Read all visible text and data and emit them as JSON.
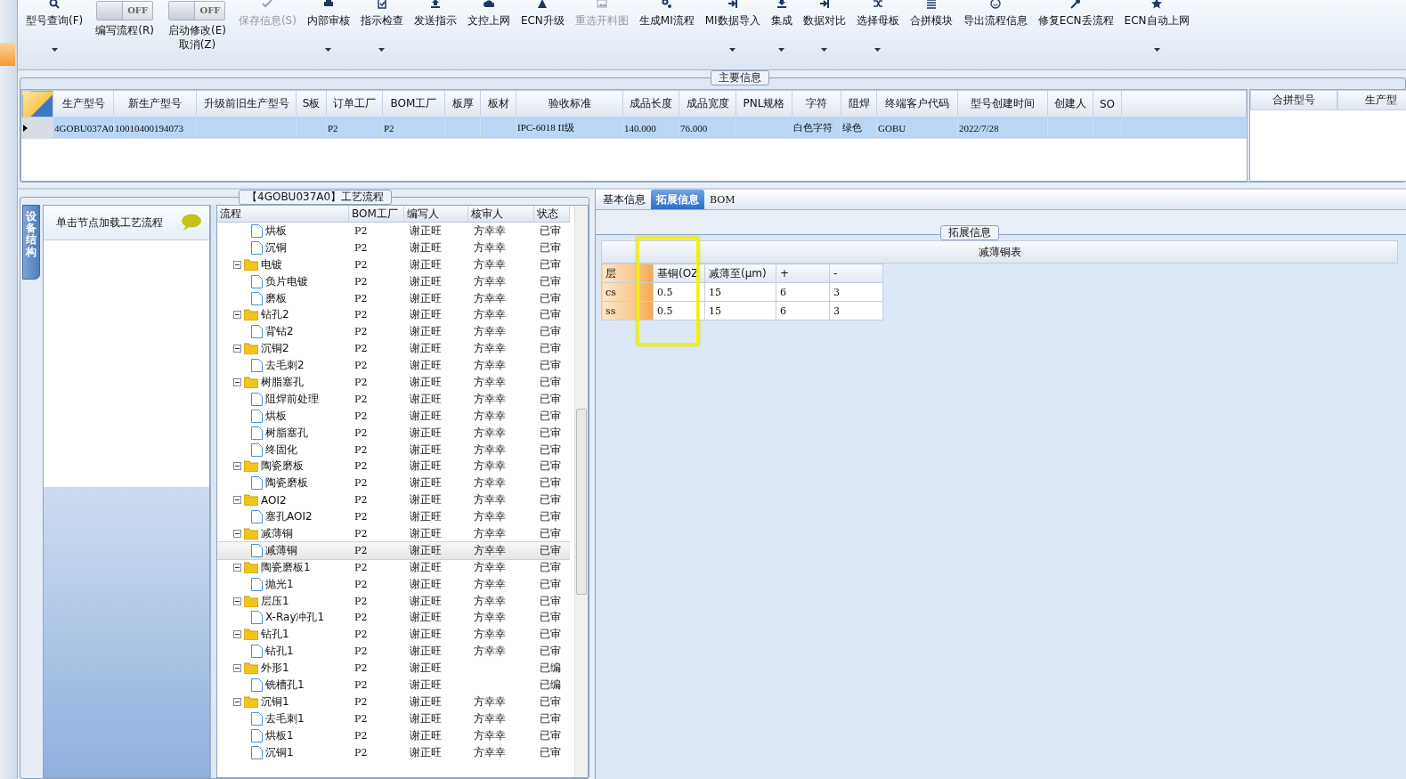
{
  "toolbar": {
    "items": [
      {
        "kind": "button",
        "label": "型号查询(F)",
        "disabled": false,
        "dropdown": true
      },
      {
        "kind": "toggle",
        "switch_text": "OFF",
        "on": false,
        "caption": [
          "编写流程(R)"
        ]
      },
      {
        "kind": "toggle",
        "switch_text": "OFF",
        "on": false,
        "caption": [
          "启动修改(E)",
          "取消(Z)"
        ]
      },
      {
        "kind": "button",
        "label": "保存信息(S)",
        "disabled": true,
        "dropdown": false
      },
      {
        "kind": "button",
        "label": "内部审核",
        "disabled": false,
        "dropdown": true
      },
      {
        "kind": "button",
        "label": "指示检查",
        "disabled": false,
        "dropdown": true
      },
      {
        "kind": "button",
        "label": "发送指示",
        "disabled": false,
        "dropdown": false
      },
      {
        "kind": "button",
        "label": "文控上网",
        "disabled": false,
        "dropdown": false
      },
      {
        "kind": "button",
        "label": "ECN升级",
        "disabled": false,
        "dropdown": false
      },
      {
        "kind": "button",
        "label": "重选开料图",
        "disabled": true,
        "dropdown": false
      },
      {
        "kind": "button",
        "label": "生成MI流程",
        "disabled": false,
        "dropdown": false
      },
      {
        "kind": "button",
        "label": "MI数据导入",
        "disabled": false,
        "dropdown": true
      },
      {
        "kind": "button",
        "label": "集成",
        "disabled": false,
        "dropdown": true
      },
      {
        "kind": "button",
        "label": "数据对比",
        "disabled": false,
        "dropdown": true
      },
      {
        "kind": "button",
        "label": "选择母板",
        "disabled": false,
        "dropdown": true
      },
      {
        "kind": "button",
        "label": "合拼模块",
        "disabled": false,
        "dropdown": false
      },
      {
        "kind": "button",
        "label": "导出流程信息",
        "disabled": false,
        "dropdown": false
      },
      {
        "kind": "button",
        "label": "修复ECN丢流程",
        "disabled": false,
        "dropdown": false
      },
      {
        "kind": "button",
        "label": "ECN自动上网",
        "disabled": false,
        "dropdown": true
      }
    ]
  },
  "main_info": {
    "title": "主要信息",
    "columns": [
      "生产型号",
      "新生产型号",
      "升级前旧生产型号",
      "S板",
      "订单工厂",
      "BOM工厂",
      "板厚",
      "板材",
      "验收标准",
      "成品长度",
      "成品宽度",
      "PNL规格",
      "字符",
      "阻焊",
      "终端客户代码",
      "型号创建时间",
      "创建人",
      "SO"
    ],
    "rows": [
      {
        "selected": true,
        "cells": [
          "4GOBU037A0",
          "10010400194073",
          null,
          null,
          "P2",
          "P2",
          null,
          null,
          "IPC-6018 II级",
          "140.000",
          "76.000",
          null,
          "白色字符",
          "绿色",
          "GOBU",
          "2022/7/28",
          null,
          null
        ]
      }
    ],
    "merge_table": {
      "columns": [
        "合拼型号",
        "生产型"
      ]
    }
  },
  "process_panel": {
    "title": "【4GOBU037A0】工艺流程",
    "side_tab": "设备结构",
    "hint": "单击节点加载工艺流程",
    "tree": {
      "columns": [
        "流程",
        "BOM工厂",
        "编写人",
        "核审人",
        "状态"
      ],
      "nodes": [
        {
          "kind": "step",
          "label": "烘板",
          "selected": false,
          "bom": "P2",
          "writer": "谢正旺",
          "reviewer": "方幸幸",
          "status": "已审"
        },
        {
          "kind": "step",
          "label": "沉铜",
          "selected": false,
          "bom": "P2",
          "writer": "谢正旺",
          "reviewer": "方幸幸",
          "status": "已审"
        },
        {
          "kind": "group",
          "label": "电镀",
          "selected": false,
          "expanded": true,
          "bom": "P2",
          "writer": "谢正旺",
          "reviewer": "方幸幸",
          "status": "已审",
          "children": [
            {
              "kind": "step",
              "label": "负片电镀",
              "selected": false,
              "bom": "P2",
              "writer": "谢正旺",
              "reviewer": "方幸幸",
              "status": "已审"
            },
            {
              "kind": "step",
              "label": "磨板",
              "selected": false,
              "bom": "P2",
              "writer": "谢正旺",
              "reviewer": "方幸幸",
              "status": "已审"
            }
          ]
        },
        {
          "kind": "group",
          "label": "钻孔2",
          "selected": false,
          "expanded": true,
          "bom": "P2",
          "writer": "谢正旺",
          "reviewer": "方幸幸",
          "status": "已审",
          "children": [
            {
              "kind": "step",
              "label": "背钻2",
              "selected": false,
              "bom": "P2",
              "writer": "谢正旺",
              "reviewer": "方幸幸",
              "status": "已审"
            }
          ]
        },
        {
          "kind": "group",
          "label": "沉铜2",
          "selected": false,
          "expanded": true,
          "bom": "P2",
          "writer": "谢正旺",
          "reviewer": "方幸幸",
          "status": "已审",
          "children": [
            {
              "kind": "step",
              "label": "去毛刺2",
              "selected": false,
              "bom": "P2",
              "writer": "谢正旺",
              "reviewer": "方幸幸",
              "status": "已审"
            }
          ]
        },
        {
          "kind": "group",
          "label": "树脂塞孔",
          "selected": false,
          "expanded": true,
          "bom": "P2",
          "writer": "谢正旺",
          "reviewer": "方幸幸",
          "status": "已审",
          "children": [
            {
              "kind": "step",
              "label": "阻焊前处理",
              "selected": false,
              "bom": "P2",
              "writer": "谢正旺",
              "reviewer": "方幸幸",
              "status": "已审"
            },
            {
              "kind": "step",
              "label": "烘板",
              "selected": false,
              "bom": "P2",
              "writer": "谢正旺",
              "reviewer": "方幸幸",
              "status": "已审"
            },
            {
              "kind": "step",
              "label": "树脂塞孔",
              "selected": false,
              "bom": "P2",
              "writer": "谢正旺",
              "reviewer": "方幸幸",
              "status": "已审"
            },
            {
              "kind": "step",
              "label": "终固化",
              "selected": false,
              "bom": "P2",
              "writer": "谢正旺",
              "reviewer": "方幸幸",
              "status": "已审"
            }
          ]
        },
        {
          "kind": "group",
          "label": "陶瓷磨板",
          "selected": false,
          "expanded": true,
          "bom": "P2",
          "writer": "谢正旺",
          "reviewer": "方幸幸",
          "status": "已审",
          "children": [
            {
              "kind": "step",
              "label": "陶瓷磨板",
              "selected": false,
              "bom": "P2",
              "writer": "谢正旺",
              "reviewer": "方幸幸",
              "status": "已审"
            }
          ]
        },
        {
          "kind": "group",
          "label": "AOI2",
          "selected": false,
          "expanded": true,
          "bom": "P2",
          "writer": "谢正旺",
          "reviewer": "方幸幸",
          "status": "已审",
          "children": [
            {
              "kind": "step",
              "label": "塞孔AOI2",
              "selected": false,
              "bom": "P2",
              "writer": "谢正旺",
              "reviewer": "方幸幸",
              "status": "已审"
            }
          ]
        },
        {
          "kind": "group",
          "label": "减薄铜",
          "selected": false,
          "expanded": true,
          "bom": "P2",
          "writer": "谢正旺",
          "reviewer": "方幸幸",
          "status": "已审",
          "children": [
            {
              "kind": "step",
              "label": "减薄铜",
              "selected": true,
              "bom": "P2",
              "writer": "谢正旺",
              "reviewer": "方幸幸",
              "status": "已审"
            }
          ]
        },
        {
          "kind": "group",
          "label": "陶瓷磨板1",
          "selected": false,
          "expanded": true,
          "bom": "P2",
          "writer": "谢正旺",
          "reviewer": "方幸幸",
          "status": "已审",
          "children": [
            {
              "kind": "step",
              "label": "抛光1",
              "selected": false,
              "bom": "P2",
              "writer": "谢正旺",
              "reviewer": "方幸幸",
              "status": "已审"
            }
          ]
        },
        {
          "kind": "group",
          "label": "层压1",
          "selected": false,
          "expanded": true,
          "bom": "P2",
          "writer": "谢正旺",
          "reviewer": "方幸幸",
          "status": "已审",
          "children": [
            {
              "kind": "step",
              "label": "X-Ray冲孔1",
              "selected": false,
              "bom": "P2",
              "writer": "谢正旺",
              "reviewer": "方幸幸",
              "status": "已审"
            }
          ]
        },
        {
          "kind": "group",
          "label": "钻孔1",
          "selected": false,
          "expanded": true,
          "bom": "P2",
          "writer": "谢正旺",
          "reviewer": "方幸幸",
          "status": "已审",
          "children": [
            {
              "kind": "step",
              "label": "钻孔1",
              "selected": false,
              "bom": "P2",
              "writer": "谢正旺",
              "reviewer": "方幸幸",
              "status": "已审"
            }
          ]
        },
        {
          "kind": "group",
          "label": "外形1",
          "selected": false,
          "expanded": true,
          "bom": "P2",
          "writer": "谢正旺",
          "status": "已编",
          "children": [
            {
              "kind": "step",
              "label": "铣槽孔1",
              "selected": false,
              "bom": "P2",
              "writer": "谢正旺",
              "status": "已编"
            }
          ]
        },
        {
          "kind": "group",
          "label": "沉铜1",
          "selected": false,
          "expanded": true,
          "bom": "P2",
          "writer": "谢正旺",
          "reviewer": "方幸幸",
          "status": "已审",
          "children": [
            {
              "kind": "step",
              "label": "去毛刺1",
              "selected": false,
              "bom": "P2",
              "writer": "谢正旺",
              "reviewer": "方幸幸",
              "status": "已审"
            },
            {
              "kind": "step",
              "label": "烘板1",
              "selected": false,
              "bom": "P2",
              "writer": "谢正旺",
              "reviewer": "方幸幸",
              "status": "已审"
            },
            {
              "kind": "step",
              "label": "沉铜1",
              "selected": false,
              "bom": "P2",
              "writer": "谢正旺",
              "reviewer": "方幸幸",
              "status": "已审"
            }
          ]
        }
      ]
    }
  },
  "detail_panel": {
    "tabs": [
      {
        "label": "基本信息",
        "selected": false
      },
      {
        "label": "拓展信息",
        "selected": true
      },
      {
        "label": "BOM",
        "selected": false
      }
    ],
    "group_title": "拓展信息",
    "table": {
      "title": "减薄铜表",
      "columns": [
        {
          "label": "层",
          "highlighted": false
        },
        {
          "label": "基铜(OZ",
          "highlighted": true
        },
        {
          "label": "减薄至(μm)",
          "highlighted": false
        },
        {
          "label": "+",
          "highlighted": false
        },
        {
          "label": "-",
          "highlighted": false
        }
      ],
      "rows": [
        [
          "cs",
          "0.5",
          "15",
          "6",
          "3"
        ],
        [
          "ss",
          "0.5",
          "15",
          "6",
          "3"
        ]
      ]
    }
  }
}
